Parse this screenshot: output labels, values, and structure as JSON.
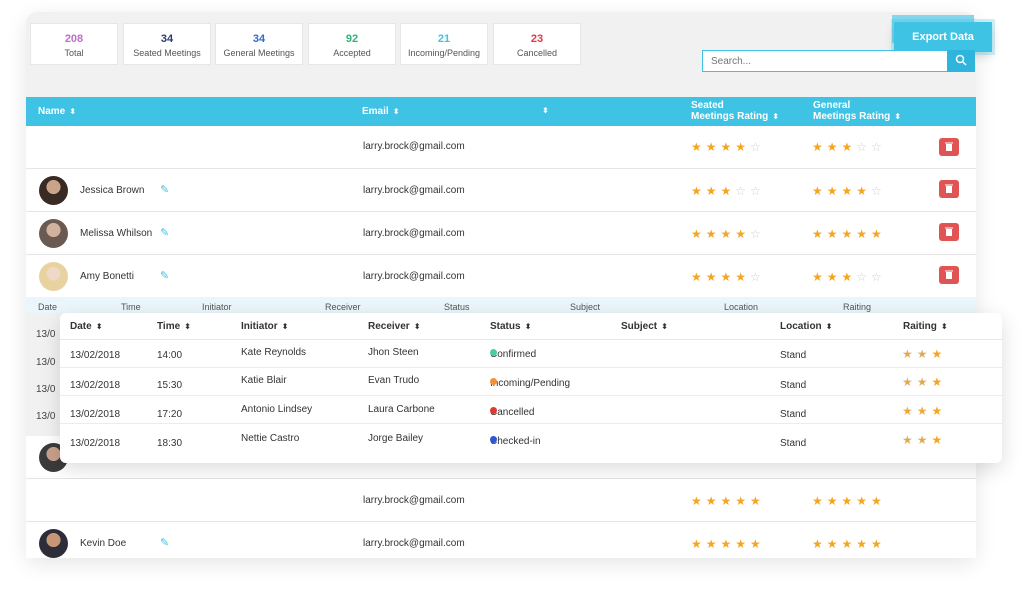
{
  "stats": [
    {
      "value": "208",
      "label": "Total",
      "color": "#c06ec9"
    },
    {
      "value": "34",
      "label": "Seated Meetings",
      "color": "#2b3a73"
    },
    {
      "value": "34",
      "label": "General Meetings",
      "color": "#2e6ad0"
    },
    {
      "value": "92",
      "label": "Accepted",
      "color": "#2fb57a"
    },
    {
      "value": "21",
      "label": "Incoming/Pending",
      "color": "#3ec3e5"
    },
    {
      "value": "23",
      "label": "Cancelled",
      "color": "#e0394a"
    }
  ],
  "toolbar": {
    "export_label": "Export Data",
    "search_placeholder": "Search..."
  },
  "table": {
    "headers": {
      "name": "Name",
      "email": "Email",
      "seated_1": "Seated",
      "seated_2": "Meetings Rating",
      "general_1": "General",
      "general_2": "Meetings Rating"
    },
    "rows": [
      {
        "name": "",
        "email": "larry.brock@gmail.com",
        "seated": 4,
        "general": 3
      },
      {
        "name": "Jessica Brown",
        "email": "larry.brock@gmail.com",
        "seated": 3,
        "general": 4
      },
      {
        "name": "Melissa Whilson",
        "email": "larry.brock@gmail.com",
        "seated": 4,
        "general": 5
      },
      {
        "name": "Amy Bonetti",
        "email": "larry.brock@gmail.com",
        "seated": 4,
        "general": 3
      },
      {
        "name": "",
        "email": "larry.brock@gmail.com",
        "seated": 5,
        "general": 5
      },
      {
        "name": "Kevin Doe",
        "email": "larry.brock@gmail.com",
        "seated": 5,
        "general": 5
      }
    ]
  },
  "subtable": {
    "headers": [
      "Date",
      "Time",
      "Initiator",
      "Receiver",
      "Status",
      "Subject",
      "Location",
      "Raiting"
    ],
    "left_dates": [
      "13/0",
      "13/0",
      "13/0",
      "13/0"
    ]
  },
  "overlay": {
    "headers": {
      "date": "Date",
      "time": "Time",
      "initiator": "Initiator",
      "receiver": "Receiver",
      "status": "Status",
      "subject": "Subject",
      "location": "Location",
      "rating": "Raiting"
    },
    "rows": [
      {
        "date": "13/02/2018",
        "time": "14:00",
        "initiator": "Kate Reynolds",
        "receiver": "Jhon Steen",
        "status": "Confirmed",
        "status_color": "#4ccf9a",
        "location": "Stand",
        "rating": 3
      },
      {
        "date": "13/02/2018",
        "time": "15:30",
        "initiator": "Katie Blair",
        "receiver": "Evan Trudo",
        "status": "Incoming/Pending",
        "status_color": "#f2913c",
        "location": "Stand",
        "rating": 3
      },
      {
        "date": "13/02/2018",
        "time": "17:20",
        "initiator": "Antonio Lindsey",
        "receiver": "Laura Carbone",
        "status": "Cancelled",
        "status_color": "#e0392d",
        "location": "Stand",
        "rating": 3
      },
      {
        "date": "13/02/2018",
        "time": "18:30",
        "initiator": "Nettie Castro",
        "receiver": "Jorge Bailey",
        "status": "Checked-in",
        "status_color": "#2a58d6",
        "location": "Stand",
        "rating": 3
      }
    ]
  }
}
